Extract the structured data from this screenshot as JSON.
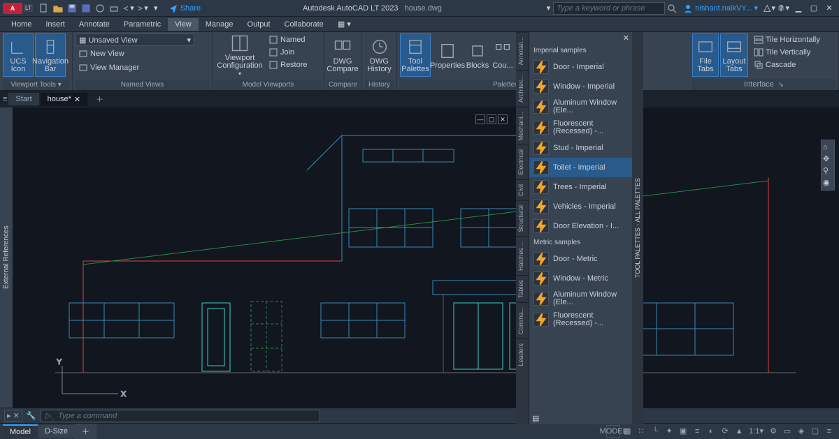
{
  "title": {
    "app": "Autodesk AutoCAD LT 2023",
    "file": "house.dwg"
  },
  "search_placeholder": "Type a keyword or phrase",
  "user": "nishant.naikVY...",
  "share": "Share",
  "menu": [
    "Home",
    "Insert",
    "Annotate",
    "Parametric",
    "View",
    "Manage",
    "Output",
    "Collaborate"
  ],
  "menu_active": 4,
  "ribbon": {
    "viewport_tools": {
      "label": "Viewport Tools ▾",
      "ucs": "UCS Icon",
      "nav": "Navigation Bar"
    },
    "named_views": {
      "label": "Named Views",
      "combo": "Unsaved View",
      "new": "New View",
      "mgr": "View Manager"
    },
    "model_viewports": {
      "label": "Model Viewports",
      "config": "Viewport Configuration",
      "named": "Named",
      "join": "Join",
      "restore": "Restore"
    },
    "compare": {
      "label": "Compare",
      "dwgc": "DWG Compare"
    },
    "history": {
      "label": "History",
      "dwgh": "DWG History"
    },
    "palettes": {
      "label": "Palettes ▾",
      "tool": "Tool Palettes",
      "prop": "Properties",
      "blocks": "Blocks",
      "count": "Cou..."
    },
    "interface": {
      "label": "Interface",
      "filetabs": "File Tabs",
      "layouttabs": "Layout Tabs",
      "th": "Tile Horizontally",
      "tv": "Tile Vertically",
      "cascade": "Cascade"
    }
  },
  "file_tabs": [
    {
      "name": "Start"
    },
    {
      "name": "house*",
      "active": true
    }
  ],
  "ext_refs": "External References",
  "palette": {
    "title": "TOOL PALETTES - ALL PALETTES",
    "tabs": [
      "Annotati...",
      "Architec...",
      "Mechani...",
      "Electrical",
      "Civil",
      "Structural",
      "Hatches ...",
      "Tables",
      "Comma...",
      "Leaders"
    ],
    "sec1": "Imperial samples",
    "items1": [
      {
        "n": "Door - Imperial"
      },
      {
        "n": "Window - Imperial"
      },
      {
        "n": "Aluminum Window  (Ele..."
      },
      {
        "n": "Fluorescent (Recessed)  -..."
      },
      {
        "n": "Stud - Imperial"
      },
      {
        "n": "Toilet - Imperial",
        "sel": true
      },
      {
        "n": "Trees - Imperial"
      },
      {
        "n": "Vehicles - Imperial"
      },
      {
        "n": "Door Elevation  - I..."
      }
    ],
    "sec2": "Metric samples",
    "items2": [
      {
        "n": "Door - Metric"
      },
      {
        "n": "Window - Metric"
      },
      {
        "n": "Aluminum Window (Ele..."
      },
      {
        "n": "Fluorescent (Recessed)  -..."
      }
    ]
  },
  "cmd_placeholder": "Type a command",
  "status": {
    "model": "Model",
    "dsize": "D-Size",
    "model2": "MODEL",
    "scale": "1:1"
  }
}
